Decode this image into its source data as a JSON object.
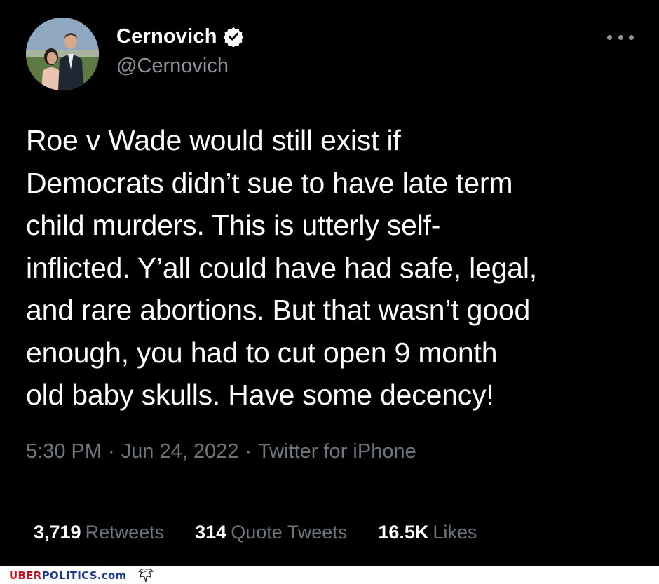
{
  "author": {
    "display_name": "Cernovich",
    "handle": "@Cernovich"
  },
  "tweet": {
    "lines": [
      "Roe v Wade would still exist if",
      "Democrats didn’t sue to have late term",
      "child murders. This is utterly self-",
      "inflicted. Y’all could have had safe, legal,",
      "and rare abortions. But that wasn’t good",
      "enough, you had to cut open 9 month",
      "old baby skulls. Have some decency!"
    ],
    "time": "5:30 PM",
    "date": "Jun 24, 2022",
    "source": "Twitter for iPhone",
    "separator": "·"
  },
  "stats": {
    "retweets_count": "3,719",
    "retweets_label": "Retweets",
    "quotes_count": "314",
    "quotes_label": "Quote Tweets",
    "likes_count": "16.5K",
    "likes_label": "Likes"
  },
  "watermark": {
    "part1": "UBER",
    "part2": "POLITICS.com"
  },
  "icons": {
    "verified": "verified-badge-icon",
    "more": "more-options-icon",
    "eagle": "eagle-logo-icon"
  },
  "colors": {
    "background": "#000000",
    "text": "#ffffff",
    "secondary": "#8b9298",
    "divider": "#2f3336",
    "watermark_red": "#c1121f",
    "watermark_blue": "#1a3c8f"
  }
}
